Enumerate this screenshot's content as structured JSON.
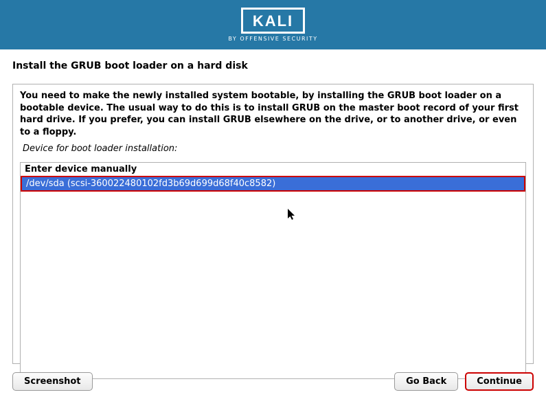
{
  "header": {
    "logo_text": "KALI",
    "logo_subtitle": "BY OFFENSIVE SECURITY"
  },
  "page_title": "Install the GRUB boot loader on a hard disk",
  "instructions": "You need to make the newly installed system bootable, by installing the GRUB boot loader on a bootable device. The usual way to do this is to install GRUB on the master boot record of your first hard drive. If you prefer, you can install GRUB elsewhere on the drive, or to another drive, or even to a floppy.",
  "device_prompt": "Device for boot loader installation:",
  "devices": {
    "manual": "Enter device manually",
    "sda": "/dev/sda  (scsi-360022480102fd3b69d699d68f40c8582)"
  },
  "buttons": {
    "screenshot": "Screenshot",
    "go_back": "Go Back",
    "continue": "Continue"
  }
}
